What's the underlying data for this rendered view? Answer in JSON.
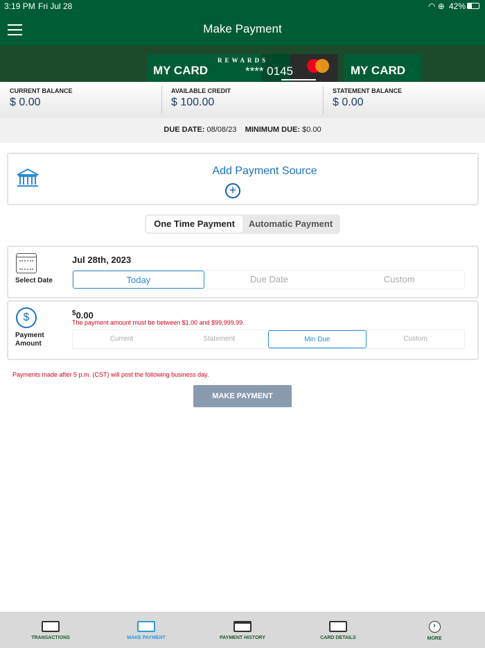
{
  "status": {
    "time": "3:19 PM",
    "date": "Fri Jul 28",
    "battery": "42%"
  },
  "header": {
    "title": "Make Payment"
  },
  "cards": [
    {
      "name": "MY CARD",
      "brand_text": "REWARDS",
      "number": "**** 0145"
    },
    {
      "name": "MY CARD"
    }
  ],
  "balances": [
    {
      "label": "CURRENT BALANCE",
      "value": "$ 0.00"
    },
    {
      "label": "AVAILABLE CREDIT",
      "value": "$ 100.00"
    },
    {
      "label": "STATEMENT BALANCE",
      "value": "$ 0.00"
    }
  ],
  "due": {
    "due_label": "DUE DATE:",
    "due_value": "08/08/23",
    "min_label": "MINIMUM DUE:",
    "min_value": "$0.00"
  },
  "payment_source": {
    "label": "Add Payment Source"
  },
  "payment_type": {
    "tabs": [
      "One Time Payment",
      "Automatic Payment"
    ]
  },
  "date": {
    "label": "Select Date",
    "value": "Jul 28th, 2023",
    "options": [
      "Today",
      "Due Date",
      "Custom"
    ]
  },
  "amount": {
    "label": "Payment Amount",
    "currency": "$",
    "value": "0.00",
    "error": "The payment amount must be between $1.00 and $99,999.99.",
    "options": [
      "Current",
      "Statement",
      "Min Due",
      "Custom"
    ]
  },
  "notice": "Payments made after 5 p.m. (CST) will post the following business day.",
  "submit": "MAKE PAYMENT",
  "tabbar": [
    "TRANSACTIONS",
    "MAKE PAYMENT",
    "PAYMENT HISTORY",
    "CARD DETAILS",
    "MORE"
  ],
  "colors": {
    "brand": "#005c35",
    "accent": "#2a8bd8",
    "error": "#d0021b"
  }
}
